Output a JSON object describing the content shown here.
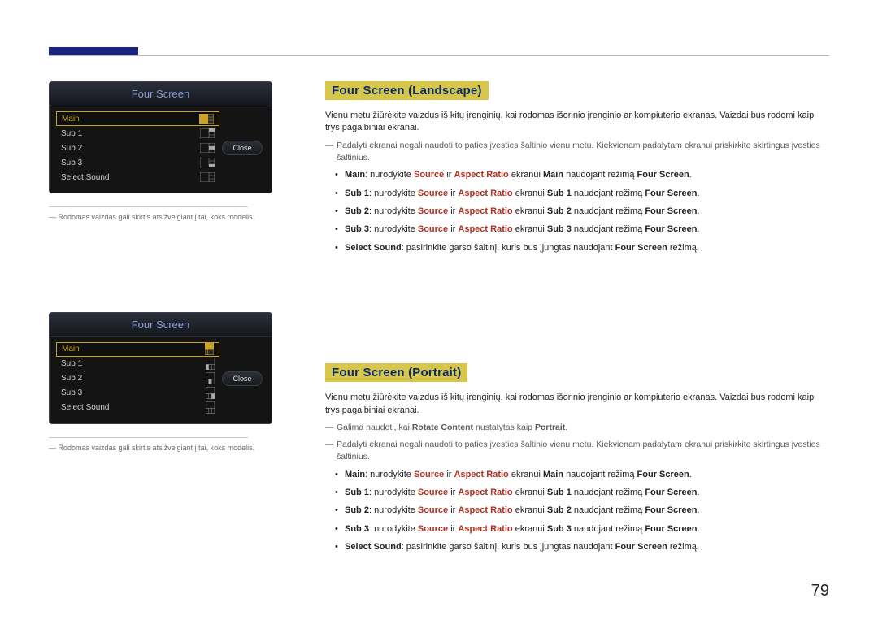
{
  "page_number": "79",
  "left_note": "Rodomas vaizdas gali skirtis atsižvelgiant į tai, koks modelis.",
  "osd": {
    "title": "Four Screen",
    "items": [
      "Main",
      "Sub 1",
      "Sub 2",
      "Sub 3",
      "Select Sound"
    ],
    "close": "Close"
  },
  "sections": {
    "landscape": {
      "heading": "Four Screen (Landscape)",
      "intro": "Vienu metu žiūrėkite vaizdus iš kitų įrenginių, kai rodomas išorinio įrenginio ar kompiuterio ekranas. Vaizdai bus rodomi kaip trys pagalbiniai ekranai.",
      "note1": "Padalyti ekranai negali naudoti to paties įvesties šaltinio vienu metu. Kiekvienam padalytam ekranui priskirkite skirtingus įvesties šaltinius."
    },
    "portrait": {
      "heading": "Four Screen (Portrait)",
      "intro": "Vienu metu žiūrėkite vaizdus iš kitų įrenginių, kai rodomas išorinio įrenginio ar kompiuterio ekranas. Vaizdai bus rodomi kaip trys pagalbiniai ekranai.",
      "note_rotate_a": "Galima naudoti, kai ",
      "note_rotate_b": "Rotate Content",
      "note_rotate_c": " nustatytas kaip ",
      "note_rotate_d": "Portrait",
      "note_rotate_e": ".",
      "note1": "Padalyti ekranai negali naudoti to paties įvesties šaltinio vienu metu. Kiekvienam padalytam ekranui priskirkite skirtingus įvesties šaltinius."
    }
  },
  "bullets": {
    "main": {
      "label": "Main",
      "t1": ": nurodykite ",
      "src": "Source",
      "t2": " ir ",
      "ar": "Aspect Ratio",
      "t3": " ekranui ",
      "sub": "Main",
      "t4": " naudojant režimą ",
      "fs": "Four Screen",
      "t5": "."
    },
    "sub1": {
      "label": "Sub 1",
      "t1": ": nurodykite ",
      "src": "Source",
      "t2": " ir ",
      "ar": "Aspect Ratio",
      "t3": " ekranui ",
      "sub": "Sub 1",
      "t4": " naudojant režimą ",
      "fs": "Four Screen",
      "t5": "."
    },
    "sub2": {
      "label": "Sub 2",
      "t1": ": nurodykite ",
      "src": "Source",
      "t2": " ir ",
      "ar": "Aspect Ratio",
      "t3": " ekranui ",
      "sub": "Sub 2",
      "t4": " naudojant režimą ",
      "fs": "Four Screen",
      "t5": "."
    },
    "sub3": {
      "label": "Sub 3",
      "t1": ": nurodykite ",
      "src": "Source",
      "t2": " ir ",
      "ar": "Aspect Ratio",
      "t3": " ekranui ",
      "sub": "Sub 3",
      "t4": " naudojant režimą ",
      "fs": "Four Screen",
      "t5": "."
    },
    "sound": {
      "label": "Select Sound",
      "t1": ": pasirinkite garso šaltinį, kuris bus įjungtas naudojant ",
      "fs": "Four Screen",
      "t2": " režimą."
    }
  }
}
